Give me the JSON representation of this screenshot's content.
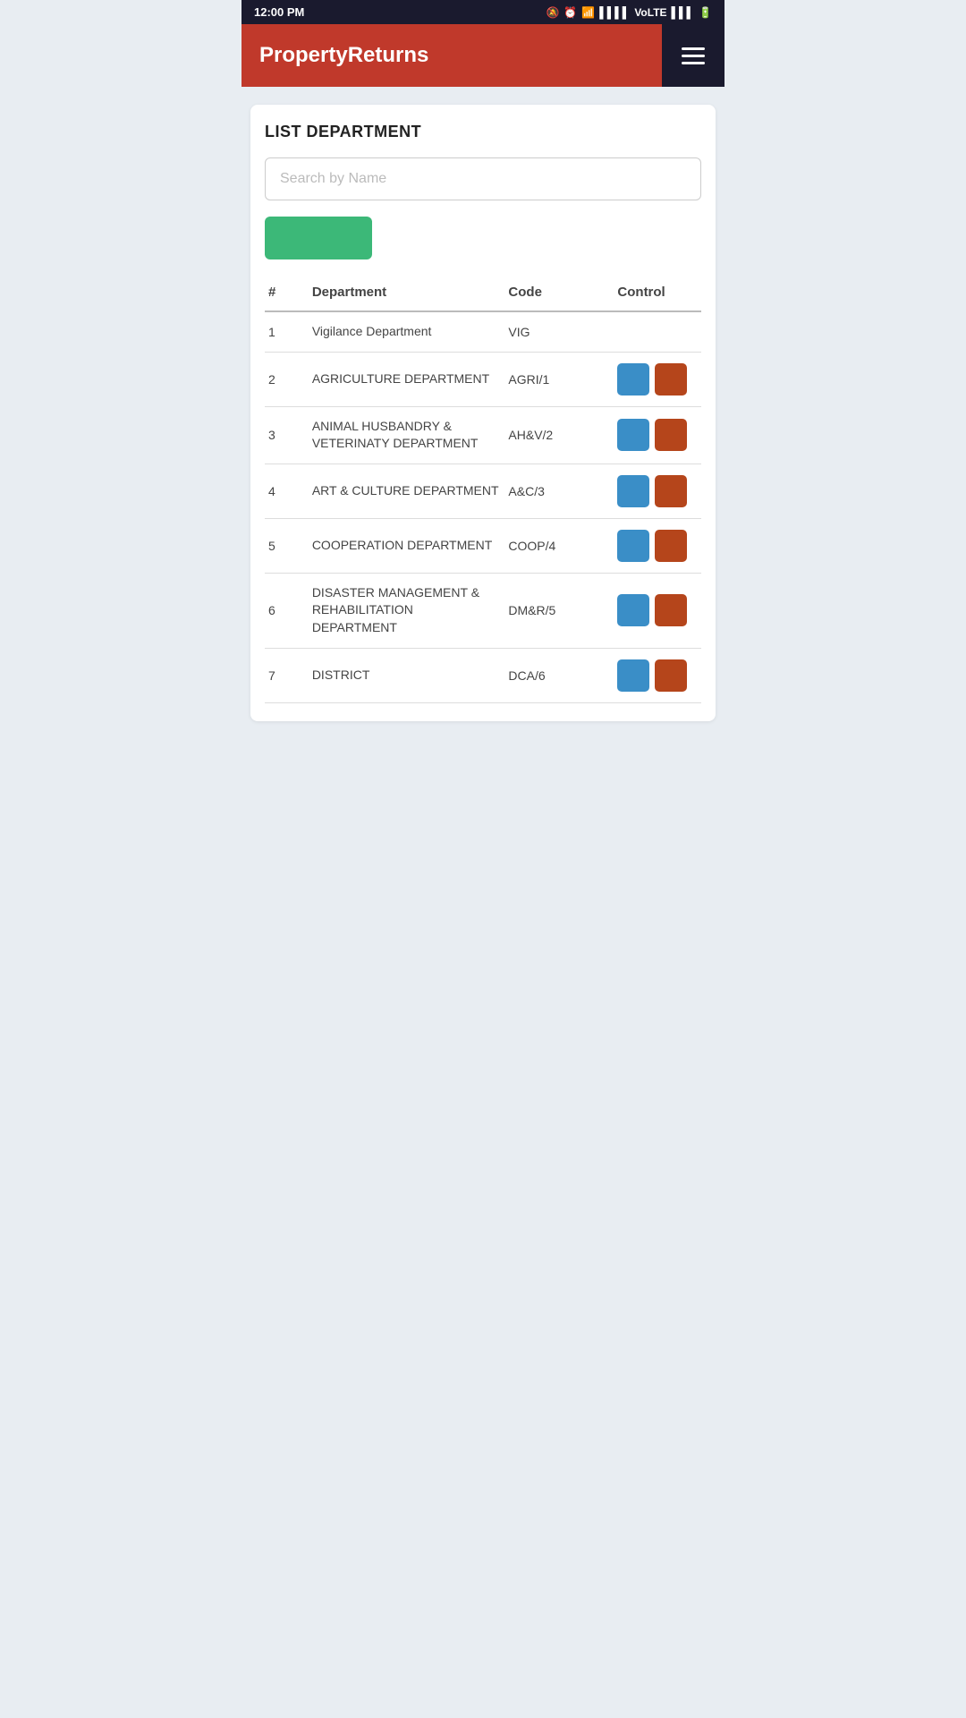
{
  "statusBar": {
    "time": "12:00 PM",
    "icons": [
      "mute",
      "alarm",
      "wifi",
      "signal",
      "VoLTE",
      "signal2",
      "battery"
    ]
  },
  "header": {
    "brand": "PropertyReturns",
    "menuIcon": "hamburger-icon"
  },
  "page": {
    "title": "LIST DEPARTMENT",
    "search": {
      "placeholder": "Search by Name",
      "value": ""
    },
    "addButton": "",
    "table": {
      "columns": [
        "#",
        "Department",
        "Code",
        "Control"
      ],
      "rows": [
        {
          "num": "1",
          "dept": "Vigilance Department",
          "code": "VIG",
          "hasControls": false
        },
        {
          "num": "2",
          "dept": "AGRICULTURE DEPARTMENT",
          "code": "AGRI/1",
          "hasControls": true
        },
        {
          "num": "3",
          "dept": "ANIMAL HUSBANDRY & VETERINATY DEPARTMENT",
          "code": "AH&V/2",
          "hasControls": true
        },
        {
          "num": "4",
          "dept": "ART & CULTURE DEPARTMENT",
          "code": "A&C/3",
          "hasControls": true
        },
        {
          "num": "5",
          "dept": "COOPERATION DEPARTMENT",
          "code": "COOP/4",
          "hasControls": true
        },
        {
          "num": "6",
          "dept": "DISASTER MANAGEMENT & REHABILITATION DEPARTMENT",
          "code": "DM&R/5",
          "hasControls": true
        },
        {
          "num": "7",
          "dept": "DISTRICT",
          "code": "DCA/6",
          "hasControls": true
        }
      ]
    }
  }
}
